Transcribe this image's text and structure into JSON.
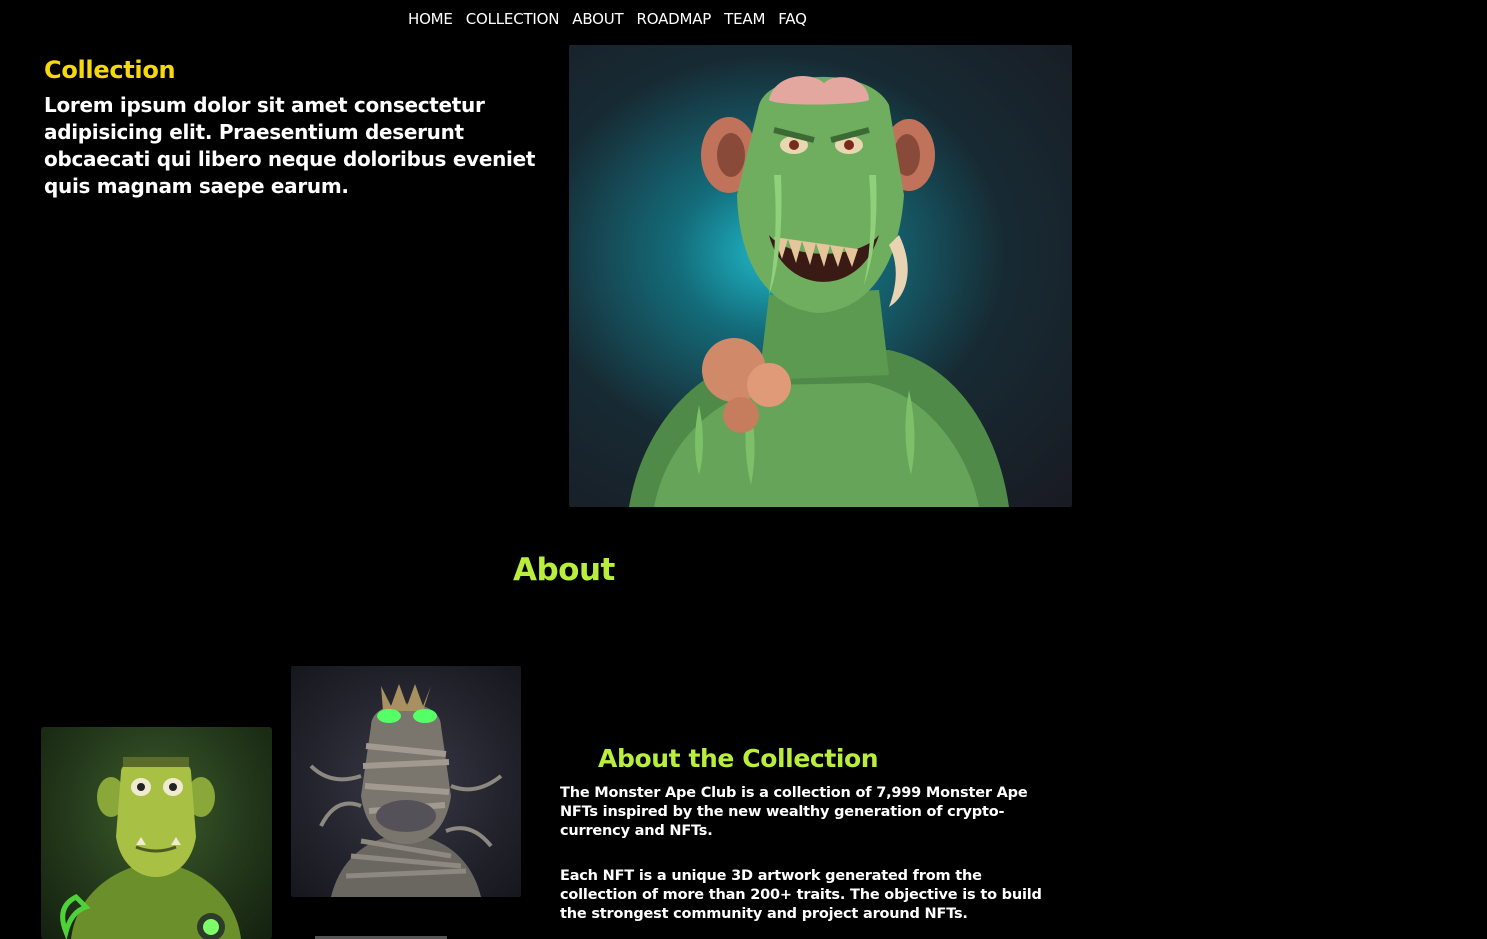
{
  "nav": {
    "items": [
      "HOME",
      "COLLECTION",
      "ABOUT",
      "ROADMAP",
      "TEAM",
      "FAQ"
    ]
  },
  "collection": {
    "title": "Collection",
    "text": "Lorem ipsum dolor sit amet consectetur adipisicing elit. Praesentium deserunt obcaecati qui libero neque doloribus eveniet quis magnam saepe earum."
  },
  "about": {
    "title": "About",
    "subtitle": "About the Collection",
    "paragraph1": "The Monster Ape Club is a collection of 7,999 Monster Ape NFTs inspired by the new wealthy generation of crypto-currency and NFTs.",
    "paragraph2": "Each NFT is a unique 3D artwork generated from the collection of more than 200+ traits. The objective is to build the strongest community and project around NFTs."
  },
  "colors": {
    "collection_heading": "#f5d90a",
    "about_heading": "#b9ef3c",
    "background": "#000000"
  }
}
